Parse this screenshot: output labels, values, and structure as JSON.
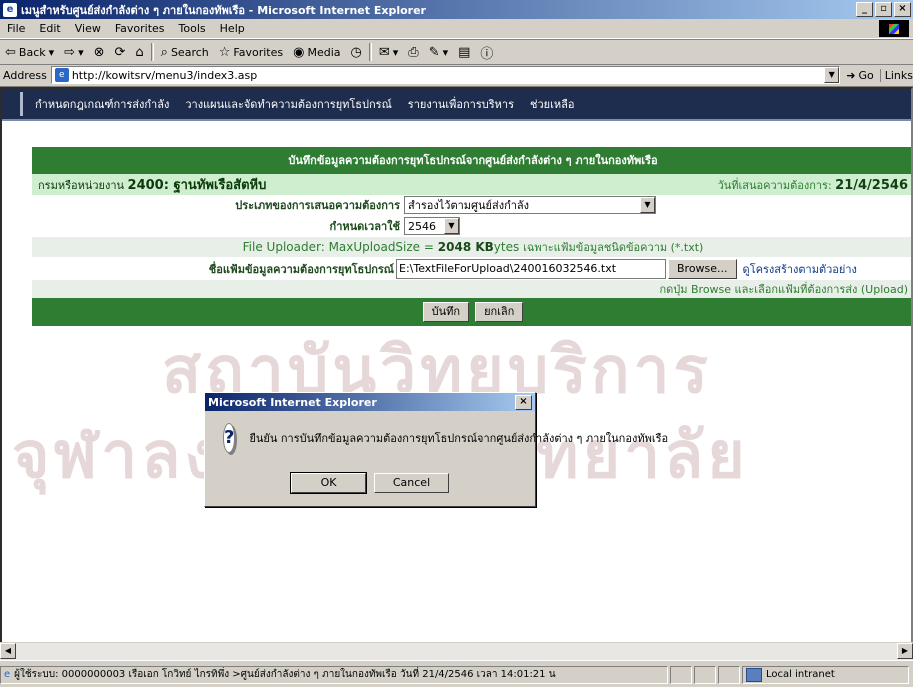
{
  "window": {
    "title": "เมนูสำหรับศูนย์ส่งกำลังต่าง ๆ ภายในกองทัพเรือ - Microsoft Internet Explorer",
    "min": "_",
    "max": "▫",
    "close": "×"
  },
  "menubar": [
    "File",
    "Edit",
    "View",
    "Favorites",
    "Tools",
    "Help"
  ],
  "toolbar": {
    "back": "Back",
    "search": "Search",
    "favorites": "Favorites",
    "media": "Media"
  },
  "address": {
    "label": "Address",
    "url": "http://kowitsrv/menu3/index3.asp",
    "go": "Go",
    "links": "Links"
  },
  "nav": [
    "กำหนดกฎเกณฑ์การส่งกำลัง",
    "วางแผนและจัดทำความต้องการยุทโธปกรณ์",
    "รายงานเพื่อการบริหาร",
    "ช่วยเหลือ"
  ],
  "form": {
    "header": "บันทึกข้อมูลความต้องการยุทโธปกรณ์จากศูนย์ส่งกำลังต่าง ๆ ภายในกองทัพเรือ",
    "dept_label": "กรมหรือหน่วยงาน",
    "dept_value": "2400: ฐานทัพเรือสัตหีบ",
    "date_label": "วันที่เสนอความต้องการ:",
    "date_value": "21/4/2546",
    "type_label": "ประเภทของการเสนอความต้องการ",
    "type_value": "สำรองไว้ตามศูนย์ส่งกำลัง",
    "year_label": "กำหนดเวลาใช้",
    "year_value": "2546",
    "uploader_title": "File Uploader:",
    "uploader_max": "MaxUploadSize =",
    "uploader_size": "2048 KB",
    "uploader_unit": "ytes",
    "uploader_note": "เฉพาะแฟ้มข้อมูลชนิดข้อความ (*.txt)",
    "file_label": "ชื่อแฟ้มข้อมูลความต้องการยุทโธปกรณ์",
    "file_value": "E:\\TextFileForUpload\\240016032546.txt",
    "browse": "Browse...",
    "sample_link": "ดูโครงสร้างตามตัวอย่าง",
    "hint": "กดปุ่ม Browse และเลือกแฟ้มที่ต้องการส่ง (Upload)",
    "save": "บันทึก",
    "cancel": "ยกเลิก"
  },
  "dialog": {
    "title": "Microsoft Internet Explorer",
    "message": "ยืนยัน  การบันทึกข้อมูลความต้องการยุทโธปกรณ์จากศูนย์ส่งกำลังต่าง ๆ ภายในกองทัพเรือ",
    "ok": "OK",
    "cancel": "Cancel"
  },
  "status": {
    "text": "ผู้ใช้ระบบ: 0000000003 เรือเอก โกวิทย์ ไกรทิพึ่ง >ศูนย์ส่งกำลังต่าง ๆ ภายในกองทัพเรือ วันที่ 21/4/2546 เวลา 14:01:21 น",
    "zone": "Local intranet"
  },
  "watermark": [
    "สถาบันวิทยบริการ",
    "จุฬาลงกรณ์มหาวิทยาลัย"
  ]
}
